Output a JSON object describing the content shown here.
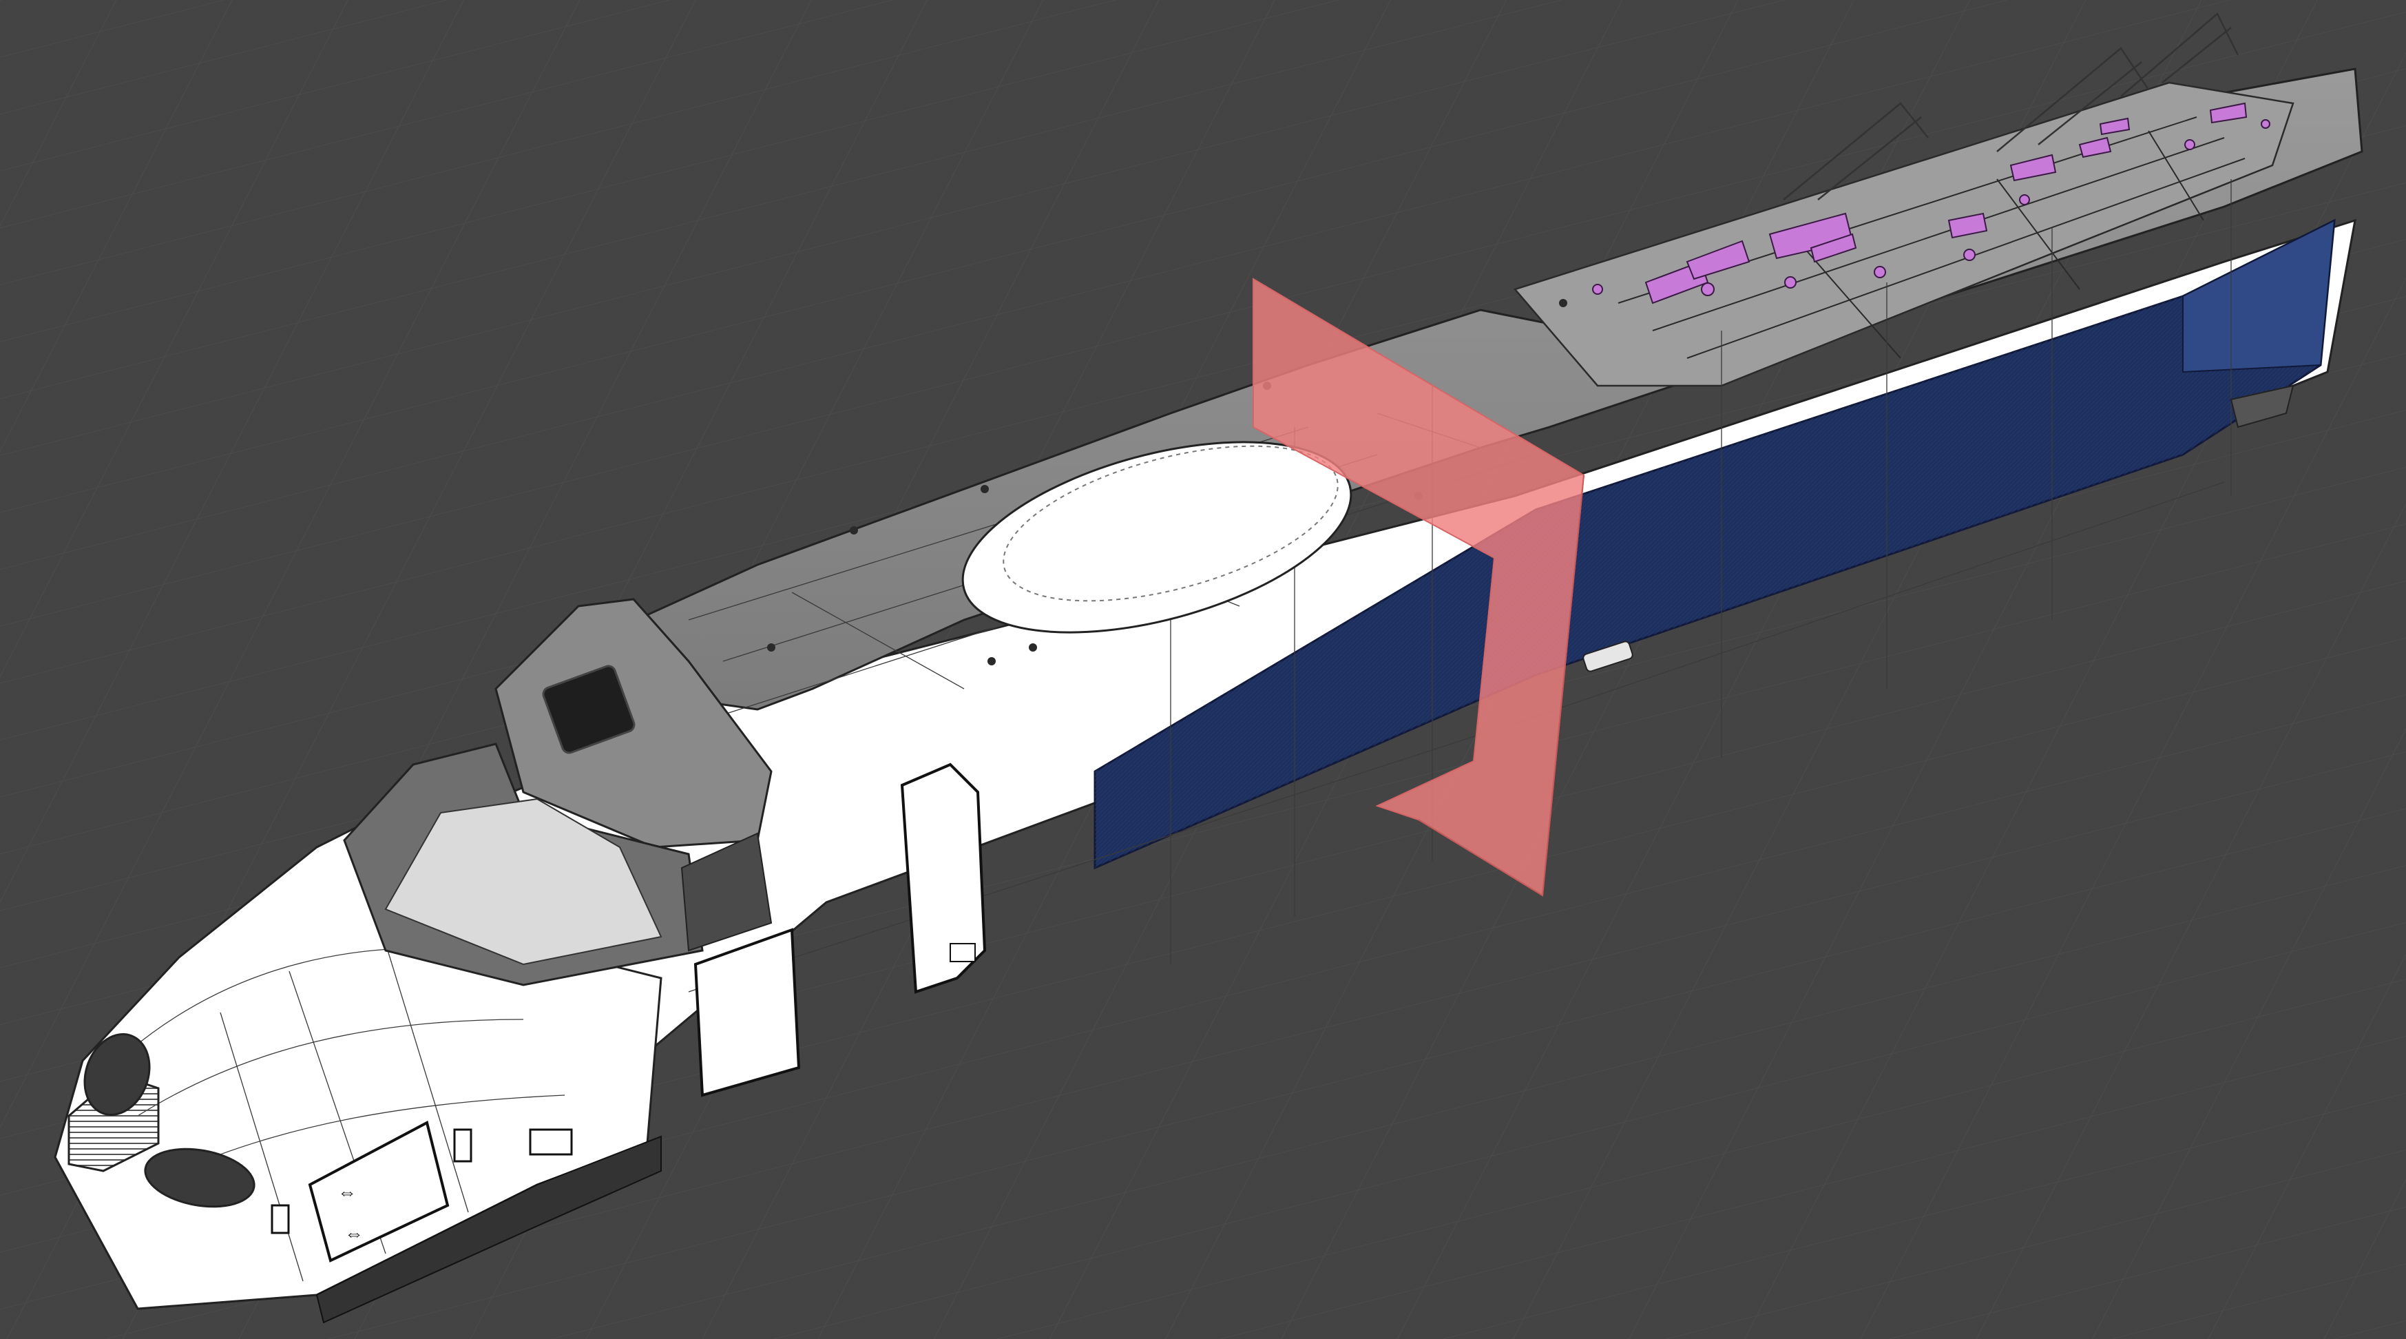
{
  "viewport": {
    "background": "#444444",
    "grid_color": "#4d4d4d"
  },
  "model": {
    "body_color": "#ffffff",
    "roof_color": "#8e8e8e",
    "stripe_color": "#1c2f5e",
    "wire_color": "#2a2a2a",
    "selection_color": "#c77ad8",
    "section_plane_color": "#f07f7f"
  },
  "icons": {
    "door_arrow_left": "double-arrow-icon",
    "door_arrow_right": "double-arrow-icon"
  }
}
